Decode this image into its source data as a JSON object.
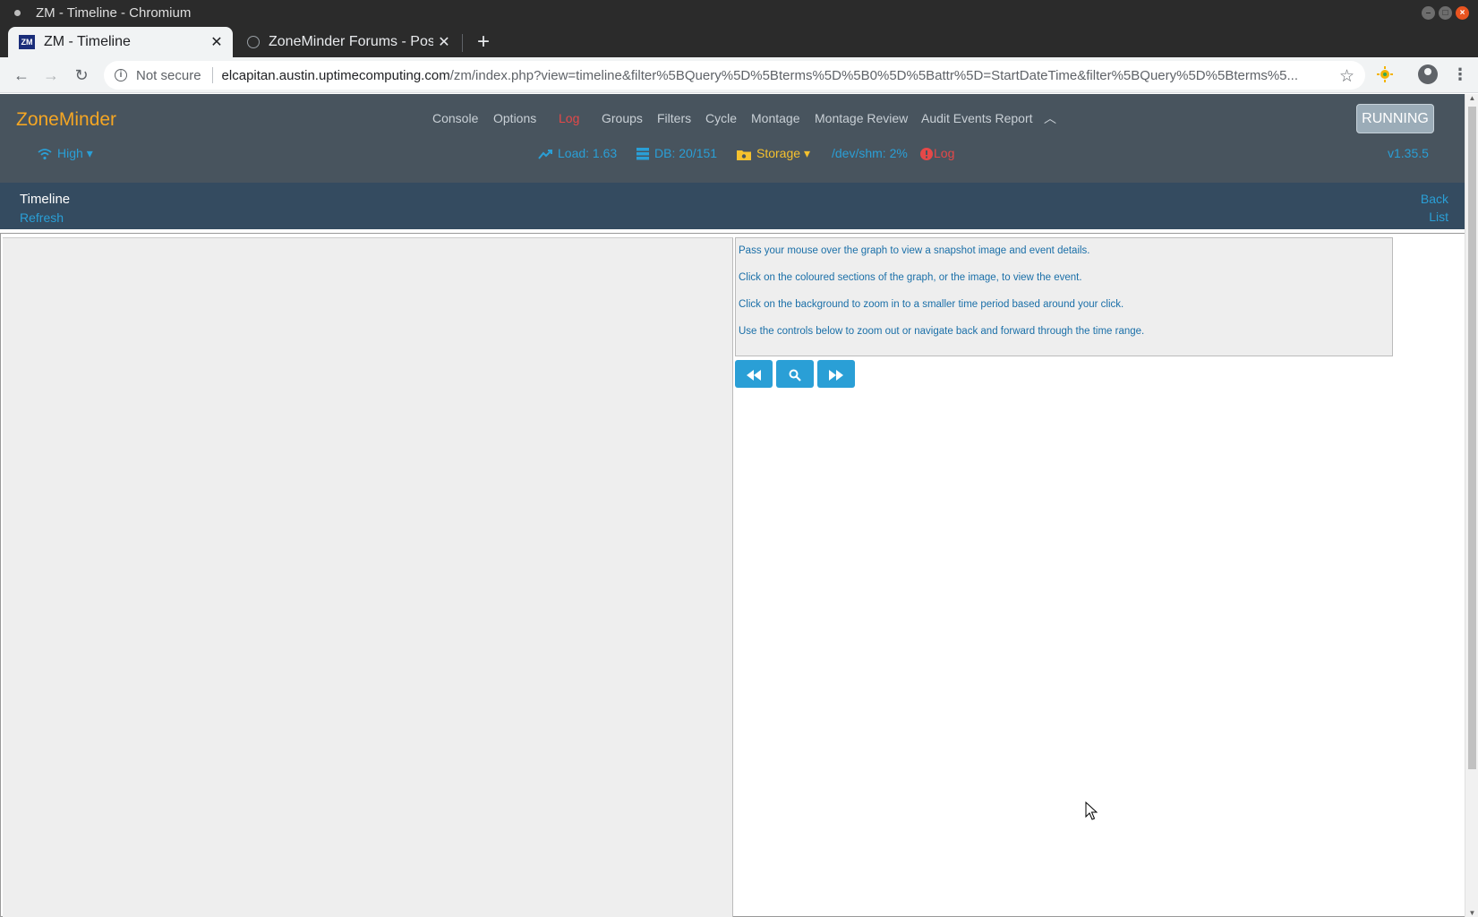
{
  "window": {
    "title": "ZM - Timeline - Chromium"
  },
  "tabs": [
    {
      "label": "ZM - Timeline",
      "favicon": "ZM"
    },
    {
      "label": "ZoneMinder Forums - Pos"
    }
  ],
  "toolbar": {
    "security_label": "Not secure",
    "url_host": "elcapitan.austin.uptimecomputing.com",
    "url_path": "/zm/index.php?view=timeline&filter%5BQuery%5D%5Bterms%5D%5B0%5D%5Battr%5D=StartDateTime&filter%5BQuery%5D%5Bterms%5..."
  },
  "zm": {
    "brand": "ZoneMinder",
    "nav": {
      "console": "Console",
      "options": "Options",
      "log": "Log",
      "groups": "Groups",
      "filters": "Filters",
      "cycle": "Cycle",
      "montage": "Montage",
      "montage_review": "Montage Review",
      "audit": "Audit Events Report"
    },
    "status_button": "RUNNING",
    "bandwidth": "High",
    "load": "Load: 1.63",
    "db": "DB: 20/151",
    "storage": "Storage",
    "shm": "/dev/shm: 2%",
    "log_status": "Log",
    "version": "v1.35.5"
  },
  "subbar": {
    "title": "Timeline",
    "refresh": "Refresh",
    "back": "Back",
    "list": "List"
  },
  "info": {
    "line1": "Pass your mouse over the graph to view a snapshot image and event details.",
    "line2": "Click on the coloured sections of the graph, or the image, to view the event.",
    "line3": "Click on the background to zoom in to a smaller time period based around your click.",
    "line4": "Use the controls below to zoom out or navigate back and forward through the time range."
  },
  "colors": {
    "brand": "#f5a623",
    "link": "#2a9fd6",
    "header_bg": "#48545e",
    "subbar_bg": "#344b60",
    "error": "#e54848"
  }
}
